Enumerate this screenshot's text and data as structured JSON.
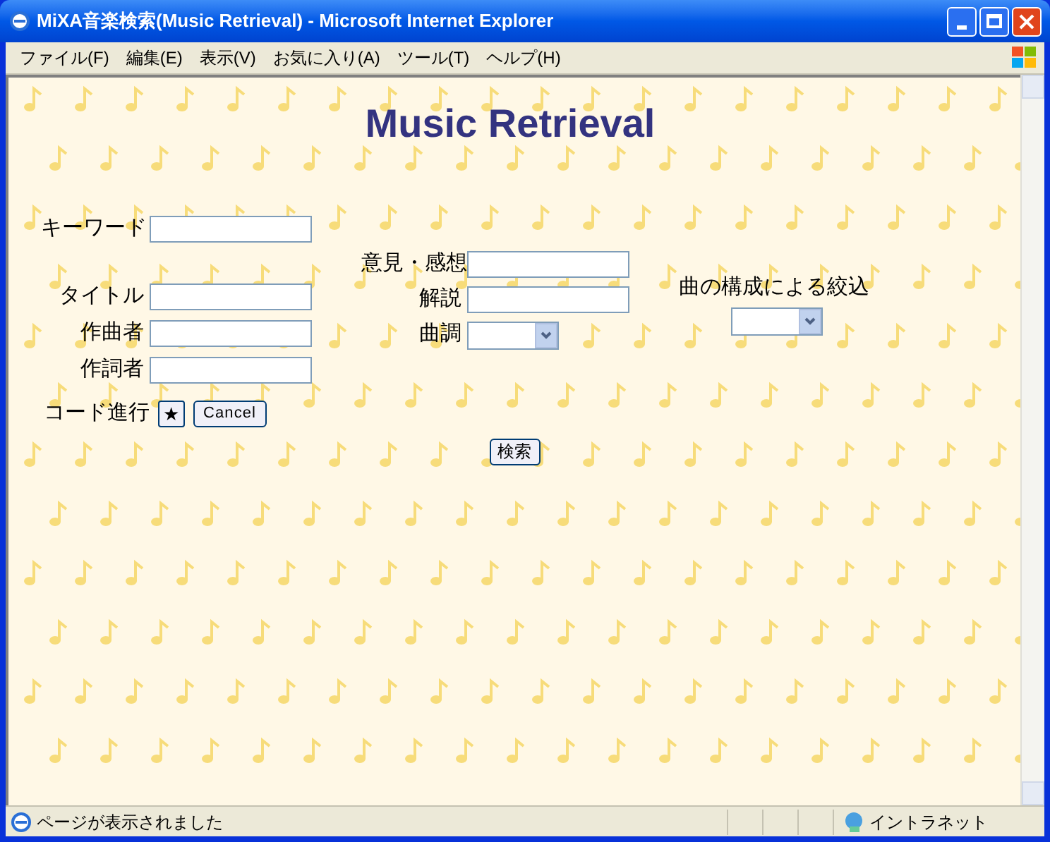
{
  "window": {
    "title": "MiXA音楽検索(Music Retrieval) - Microsoft Internet Explorer"
  },
  "menu": [
    "ファイル(F)",
    "編集(E)",
    "表示(V)",
    "お気に入り(A)",
    "ツール(T)",
    "ヘルプ(H)"
  ],
  "page": {
    "heading": "Music Retrieval",
    "left_fields": [
      {
        "label": "キーワード",
        "kind": "text"
      },
      {
        "label": "タイトル",
        "kind": "text"
      },
      {
        "label": "作曲者",
        "kind": "text"
      },
      {
        "label": "作詞者",
        "kind": "text"
      }
    ],
    "chord": {
      "label": "コード進行",
      "star_button": "★",
      "cancel_button": "Cancel"
    },
    "middle_fields": [
      {
        "label": "意見・感想",
        "kind": "text"
      },
      {
        "label": "解説",
        "kind": "text"
      },
      {
        "label": "曲調",
        "kind": "select"
      }
    ],
    "structure_filter": {
      "label": "曲の構成による絞込",
      "kind": "select"
    },
    "search_button": "検索"
  },
  "status_bar": {
    "message": "ページが表示されました",
    "zone": "イントラネット"
  }
}
